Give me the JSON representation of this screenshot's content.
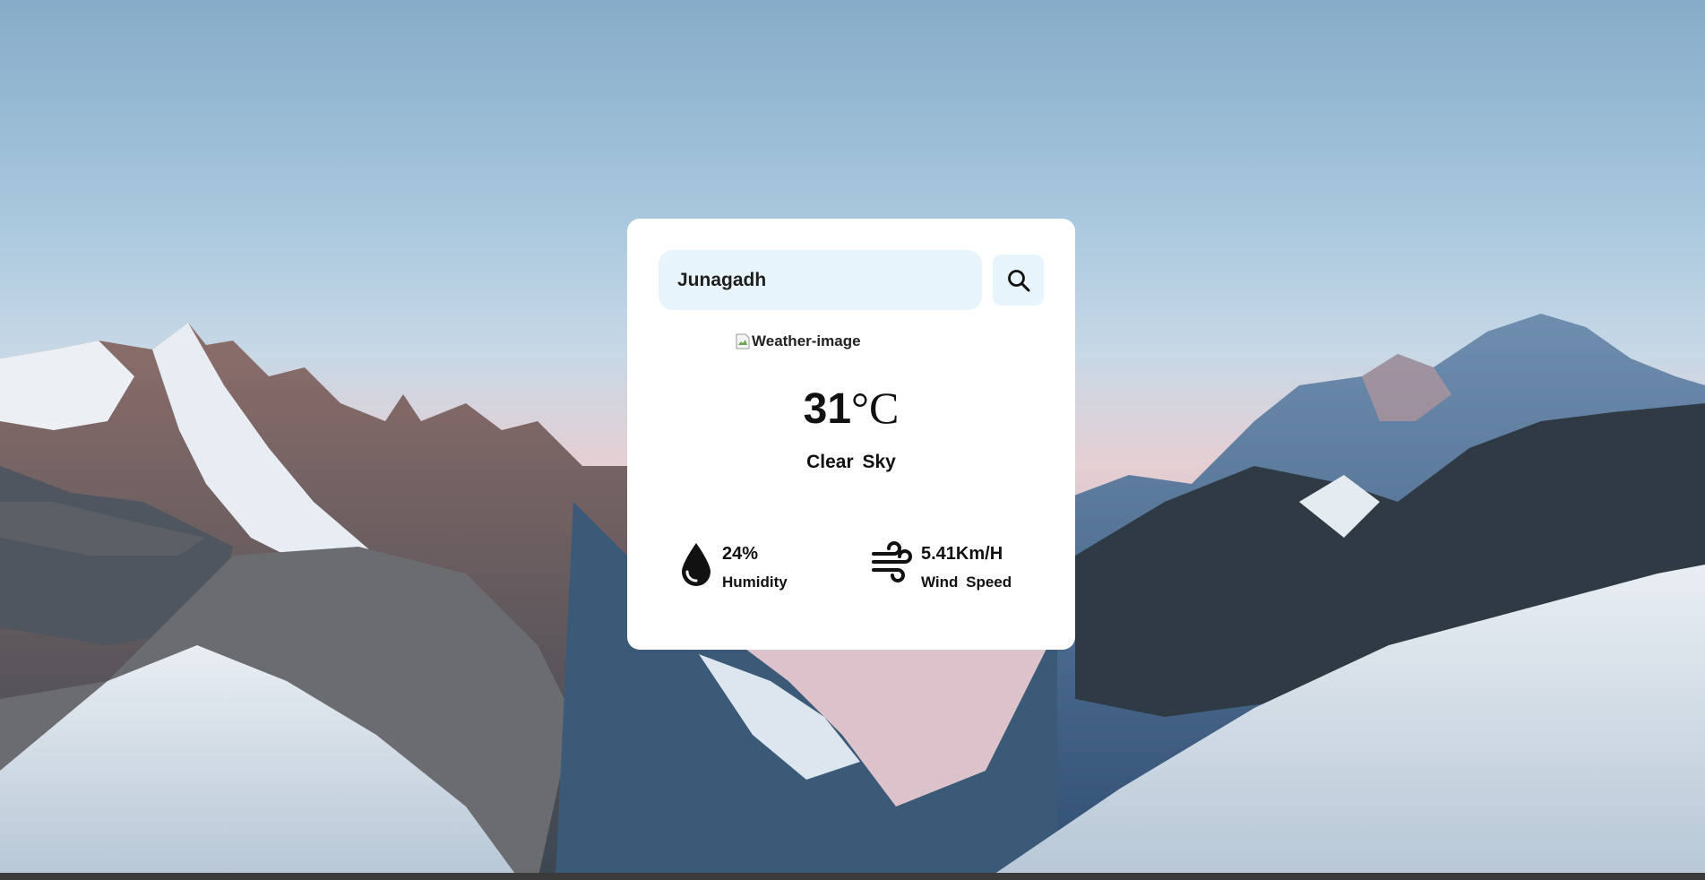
{
  "search": {
    "value": "Junagadh",
    "icon": "search-icon"
  },
  "weather": {
    "image_alt": "Weather-image",
    "temperature": "31",
    "unit": "°C",
    "description": "Clear Sky"
  },
  "stats": {
    "humidity": {
      "value": "24%",
      "label": "Humidity",
      "icon": "water-drop-icon"
    },
    "wind": {
      "value": "5.41Km/H",
      "label": "Wind Speed",
      "icon": "wind-icon"
    }
  },
  "colors": {
    "card_bg": "#ffffff",
    "input_bg": "#e8f4fb",
    "text": "#111111"
  }
}
